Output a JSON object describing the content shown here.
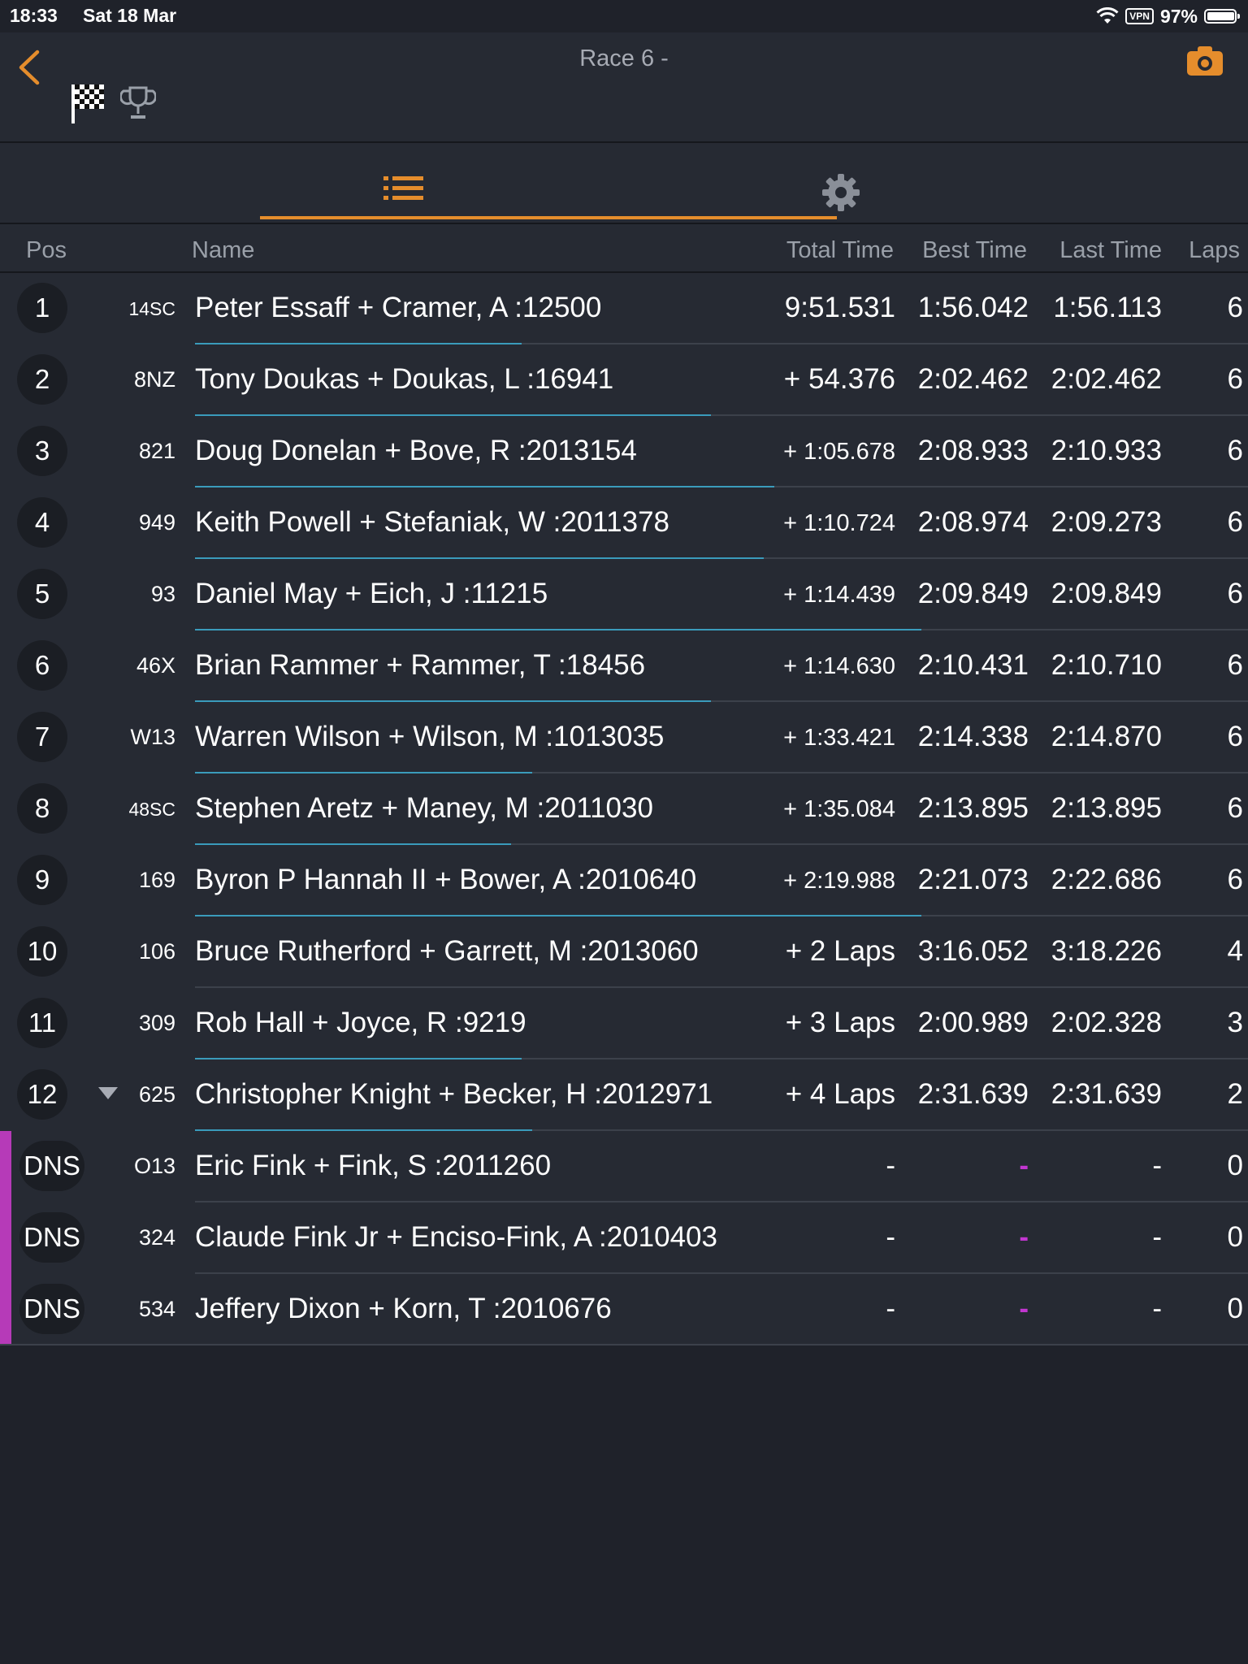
{
  "status": {
    "time": "18:33",
    "date": "Sat 18 Mar",
    "vpn": "VPN",
    "battery": "97%"
  },
  "header": {
    "title": "Race 6 -"
  },
  "icons": {
    "back": "chevron-left-icon",
    "flag": "checkered-flag-icon",
    "trophy": "trophy-icon",
    "camera": "camera-icon",
    "list": "list-icon",
    "settings": "gear-icon"
  },
  "colors": {
    "accent": "#e58d2c",
    "progress": "#3a9bbb",
    "dns": "#b63ab8"
  },
  "columns": {
    "pos": "Pos",
    "name": "Name",
    "total": "Total Time",
    "best": "Best Time",
    "last": "Last Time",
    "laps": "Laps"
  },
  "results": [
    {
      "pos": "1",
      "car": "14SC",
      "name": "Peter Essaff + Cramer, A :12500",
      "total": "9:51.531",
      "best": "1:56.042",
      "last": "1:56.113",
      "laps": "6",
      "progress": 0.31
    },
    {
      "pos": "2",
      "car": "8NZ",
      "name": "Tony Doukas + Doukas, L :16941",
      "total": "+ 54.376",
      "best": "2:02.462",
      "last": "2:02.462",
      "laps": "6",
      "progress": 0.49
    },
    {
      "pos": "3",
      "car": "821",
      "name": "Doug Donelan + Bove, R :2013154",
      "total": "+ 1:05.678",
      "best": "2:08.933",
      "last": "2:10.933",
      "laps": "6",
      "progress": 0.55
    },
    {
      "pos": "4",
      "car": "949",
      "name": "Keith Powell + Stefaniak, W :2011378",
      "total": "+ 1:10.724",
      "best": "2:08.974",
      "last": "2:09.273",
      "laps": "6",
      "progress": 0.54
    },
    {
      "pos": "5",
      "car": "93",
      "name": "Daniel May + Eich, J :11215",
      "total": "+ 1:14.439",
      "best": "2:09.849",
      "last": "2:09.849",
      "laps": "6",
      "progress": 0.69
    },
    {
      "pos": "6",
      "car": "46X",
      "name": "Brian Rammer + Rammer, T :18456",
      "total": "+ 1:14.630",
      "best": "2:10.431",
      "last": "2:10.710",
      "laps": "6",
      "progress": 0.49
    },
    {
      "pos": "7",
      "car": "W13",
      "name": "Warren Wilson + Wilson, M :1013035",
      "total": "+ 1:33.421",
      "best": "2:14.338",
      "last": "2:14.870",
      "laps": "6",
      "progress": 0.32
    },
    {
      "pos": "8",
      "car": "48SC",
      "name": "Stephen Aretz + Maney, M :2011030",
      "total": "+ 1:35.084",
      "best": "2:13.895",
      "last": "2:13.895",
      "laps": "6",
      "progress": 0.3
    },
    {
      "pos": "9",
      "car": "169",
      "name": "Byron P Hannah II + Bower, A :2010640",
      "total": "+ 2:19.988",
      "best": "2:21.073",
      "last": "2:22.686",
      "laps": "6",
      "progress": 0.69
    },
    {
      "pos": "10",
      "car": "106",
      "name": "Bruce Rutherford + Garrett, M :2013060",
      "total": "+ 2 Laps",
      "best": "3:16.052",
      "last": "3:18.226",
      "laps": "4",
      "progress": 0
    },
    {
      "pos": "11",
      "car": "309",
      "name": "Rob Hall + Joyce, R :9219",
      "total": "+ 3 Laps",
      "best": "2:00.989",
      "last": "2:02.328",
      "laps": "3",
      "progress": 0.31
    },
    {
      "pos": "12",
      "car": "625",
      "name": "Christopher Knight + Becker, H :2012971",
      "total": "+ 4 Laps",
      "best": "2:31.639",
      "last": "2:31.639",
      "laps": "2",
      "progress": 0.32,
      "dropped": true
    },
    {
      "pos": "DNS",
      "car": "O13",
      "name": "Eric Fink + Fink, S :2011260",
      "total": "-",
      "best": "-",
      "last": "-",
      "laps": "0",
      "progress": 0,
      "dns": true
    },
    {
      "pos": "DNS",
      "car": "324",
      "name": "Claude Fink Jr + Enciso-Fink, A :2010403",
      "total": "-",
      "best": "-",
      "last": "-",
      "laps": "0",
      "progress": 0,
      "dns": true
    },
    {
      "pos": "DNS",
      "car": "534",
      "name": "Jeffery Dixon + Korn, T :2010676",
      "total": "-",
      "best": "-",
      "last": "-",
      "laps": "0",
      "progress": 0,
      "dns": true
    }
  ]
}
